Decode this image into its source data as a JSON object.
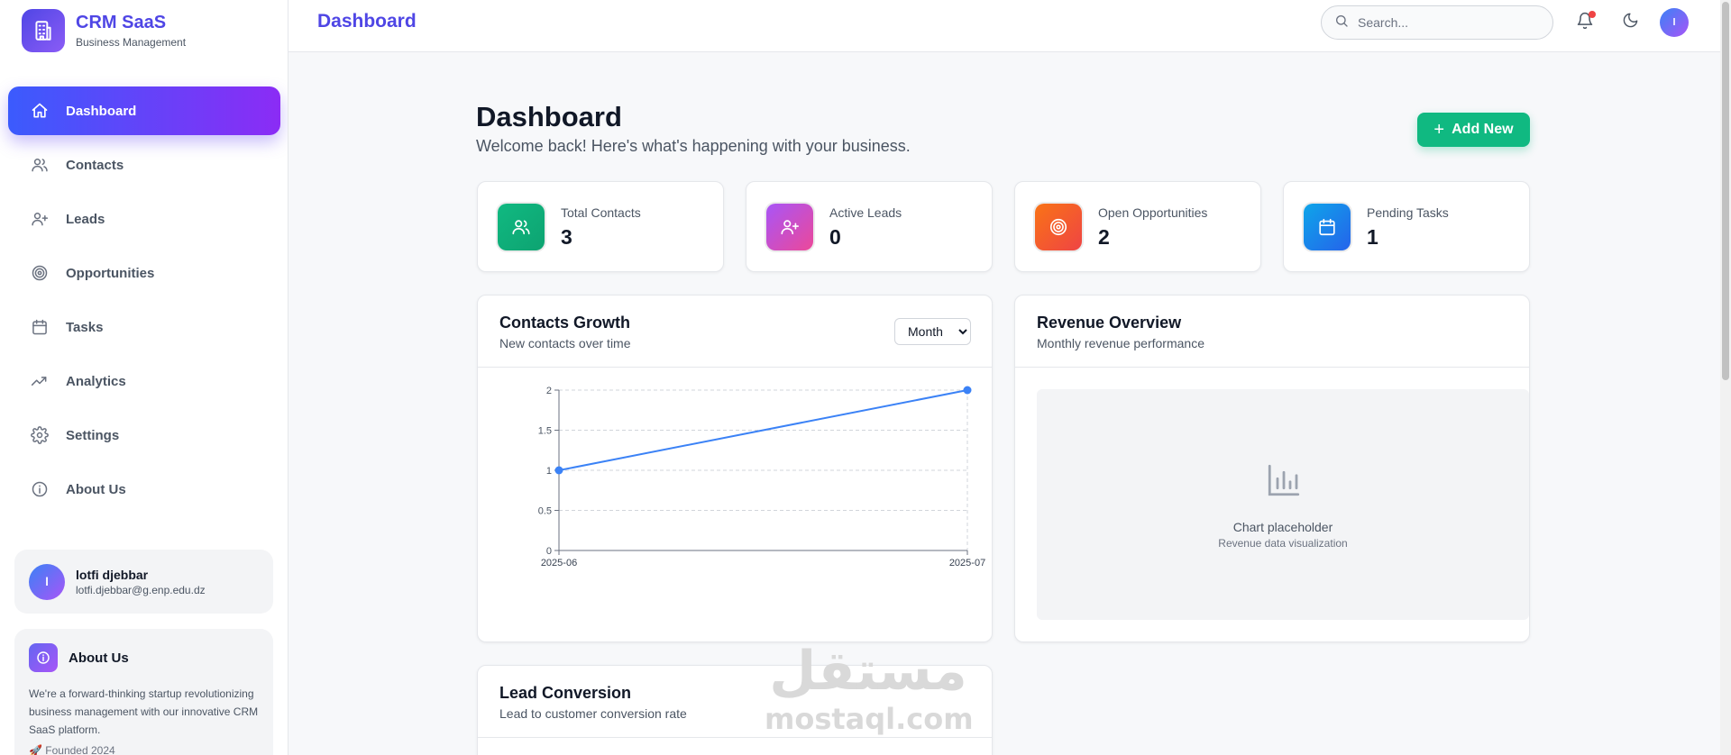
{
  "brand": {
    "title": "CRM SaaS",
    "subtitle": "Business Management",
    "logo_icon": "building-icon"
  },
  "sidebar": {
    "items": [
      {
        "label": "Dashboard",
        "icon": "home-icon",
        "active": true
      },
      {
        "label": "Contacts",
        "icon": "users-icon"
      },
      {
        "label": "Leads",
        "icon": "user-plus-icon"
      },
      {
        "label": "Opportunities",
        "icon": "target-icon"
      },
      {
        "label": "Tasks",
        "icon": "calendar-icon"
      },
      {
        "label": "Analytics",
        "icon": "trend-icon"
      },
      {
        "label": "Settings",
        "icon": "gear-icon"
      },
      {
        "label": "About Us",
        "icon": "info-icon"
      }
    ],
    "user": {
      "initial": "l",
      "name": "lotfi djebbar",
      "email": "lotfi.djebbar@g.enp.edu.dz"
    },
    "about": {
      "title": "About Us",
      "text": "We're a forward-thinking startup revolutionizing business management with our innovative CRM SaaS platform.",
      "founded": "🚀 Founded 2024"
    }
  },
  "header": {
    "title": "Dashboard",
    "search_placeholder": "Search...",
    "notification_badge": true,
    "avatar_initial": "l"
  },
  "page": {
    "title": "Dashboard",
    "subtitle": "Welcome back! Here's what's happening with your business.",
    "add_button": "Add New"
  },
  "stats": [
    {
      "label": "Total Contacts",
      "value": "3",
      "icon": "users-icon",
      "color": "#10b981"
    },
    {
      "label": "Active Leads",
      "value": "0",
      "icon": "user-plus-icon",
      "color": "#d946ef"
    },
    {
      "label": "Open Opportunities",
      "value": "2",
      "icon": "target-icon",
      "color": "#f97316"
    },
    {
      "label": "Pending Tasks",
      "value": "1",
      "icon": "calendar-icon",
      "color": "#0ea5e9"
    }
  ],
  "contacts_growth": {
    "title": "Contacts Growth",
    "subtitle": "New contacts over time",
    "period_options": [
      "Month"
    ],
    "period_selected": "Month"
  },
  "revenue": {
    "title": "Revenue Overview",
    "subtitle": "Monthly revenue performance",
    "placeholder_title": "Chart placeholder",
    "placeholder_sub": "Revenue data visualization"
  },
  "lead_conversion": {
    "title": "Lead Conversion",
    "subtitle": "Lead to customer conversion rate"
  },
  "watermark": {
    "arabic": "مستقل",
    "latin": "mostaql.com"
  },
  "colors": {
    "accent": "#4f46e5",
    "line": "#3b82f6",
    "success": "#10b981"
  },
  "chart_data": {
    "type": "line",
    "x": [
      "2025-06",
      "2025-07"
    ],
    "series": [
      {
        "values": [
          1,
          2
        ]
      }
    ],
    "ylim": [
      0,
      2
    ],
    "yticks": [
      0,
      0.5,
      1,
      1.5,
      2
    ],
    "ytick_labels": [
      "0",
      "0.5",
      "1",
      "1.5",
      "2"
    ],
    "grid": true
  }
}
